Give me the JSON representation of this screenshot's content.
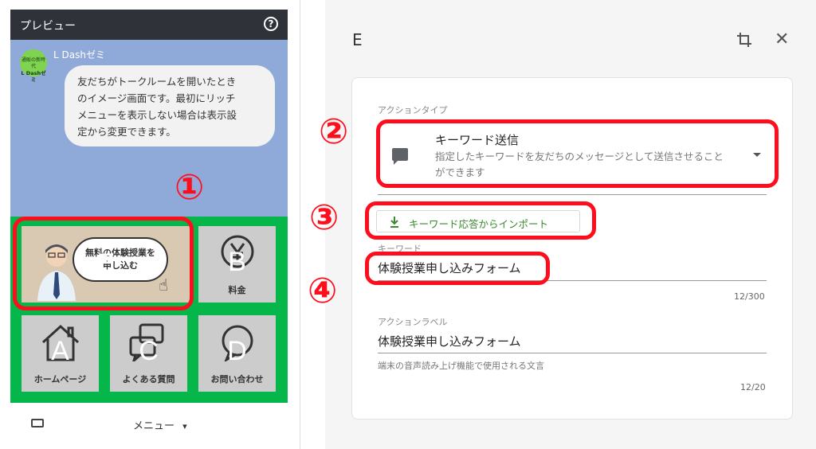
{
  "preview": {
    "title": "プレビュー",
    "help_icon": "question-circle-icon",
    "account_name": "L Dashゼミ",
    "avatar_text_line1": "通販の新時代",
    "avatar_text_line2": "L Dashゼミ",
    "message_lines": [
      "友だちがトークルームを開いたとき",
      "のイメージ画面です。最初にリッチ",
      "メニューを表示しない場合は表示設",
      "定から変更できます。"
    ],
    "tiles": {
      "E": {
        "letter": "E",
        "banner_line1": "無料の体験授業を",
        "banner_line2": "申し込む"
      },
      "B": {
        "letter": "B",
        "label": "料金",
        "icon": "yen-icon"
      },
      "A": {
        "letter": "A",
        "label": "ホームページ",
        "icon": "home-icon"
      },
      "C": {
        "letter": "C",
        "label": "よくある質問",
        "icon": "question-bubble-icon"
      },
      "D": {
        "letter": "D",
        "label": "お問い合わせ",
        "icon": "chat-bubble-icon"
      }
    },
    "footer": {
      "keyboard_icon": "keyboard-icon",
      "menu_label": "メニュー",
      "menu_caret": "▾"
    }
  },
  "annotations": {
    "n1": "①",
    "n2": "②",
    "n3": "③",
    "n4": "④",
    "color": "#ff0d1c"
  },
  "editor": {
    "title": "E",
    "crop_icon": "crop-icon",
    "close_icon": "close-icon",
    "close_glyph": "✕",
    "action_type": {
      "label": "アクションタイプ",
      "selected_title": "キーワード送信",
      "selected_desc": "指定したキーワードを友だちのメッセージとして送信させることができます",
      "icon": "message-icon"
    },
    "import_button": {
      "label": "キーワード応答からインポート",
      "icon": "download-icon"
    },
    "keyword": {
      "label": "キーワード",
      "value": "体験授業申し込みフォーム",
      "counter": "12/300"
    },
    "action_label": {
      "label": "アクションラベル",
      "value": "体験授業申し込みフォーム",
      "helper": "端末の音声読み上げ機能で使用される文言",
      "counter": "12/20"
    }
  },
  "colors": {
    "menu_green": "#05b74b",
    "chat_bg": "#8fa9d8",
    "accent_red": "#ff0d1c",
    "import_green": "#3a8a2e"
  }
}
